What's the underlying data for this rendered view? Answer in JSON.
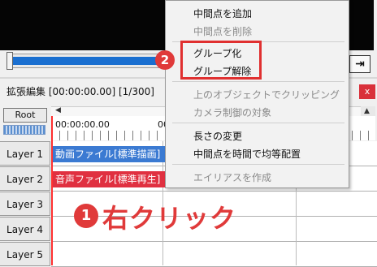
{
  "timeline": {
    "title": "拡張編集 [00:00:00.00] [1/300]",
    "close_label": "x",
    "root_label": "Root",
    "time_start": "00:00:00.00",
    "time_next": "00:00:03",
    "layers": [
      "Layer 1",
      "Layer 2",
      "Layer 3",
      "Layer 4",
      "Layer 5"
    ],
    "clips": {
      "video": "動画ファイル[標準描画]",
      "audio": "音声ファイル[標準再生]"
    }
  },
  "preview": {
    "end_button_label": "⇥"
  },
  "context_menu": {
    "items": [
      {
        "label": "中間点を追加",
        "enabled": true
      },
      {
        "label": "中間点を削除",
        "enabled": false
      },
      {
        "label": "グループ化",
        "enabled": true
      },
      {
        "label": "グループ解除",
        "enabled": true
      },
      {
        "label": "上のオブジェクトでクリッピング",
        "enabled": false
      },
      {
        "label": "カメラ制御の対象",
        "enabled": false
      },
      {
        "label": "長さの変更",
        "enabled": true
      },
      {
        "label": "中間点を時間で均等配置",
        "enabled": true
      },
      {
        "label": "エイリアスを作成",
        "enabled": false
      }
    ]
  },
  "annotations": {
    "badge1": "1",
    "badge2": "2",
    "right_click_text": "右クリック",
    "accent_color": "#e03a3a"
  },
  "colors": {
    "video_clip": "#3b7ad2",
    "audio_clip": "#e03040",
    "seek_fill": "#1a6fd0"
  }
}
